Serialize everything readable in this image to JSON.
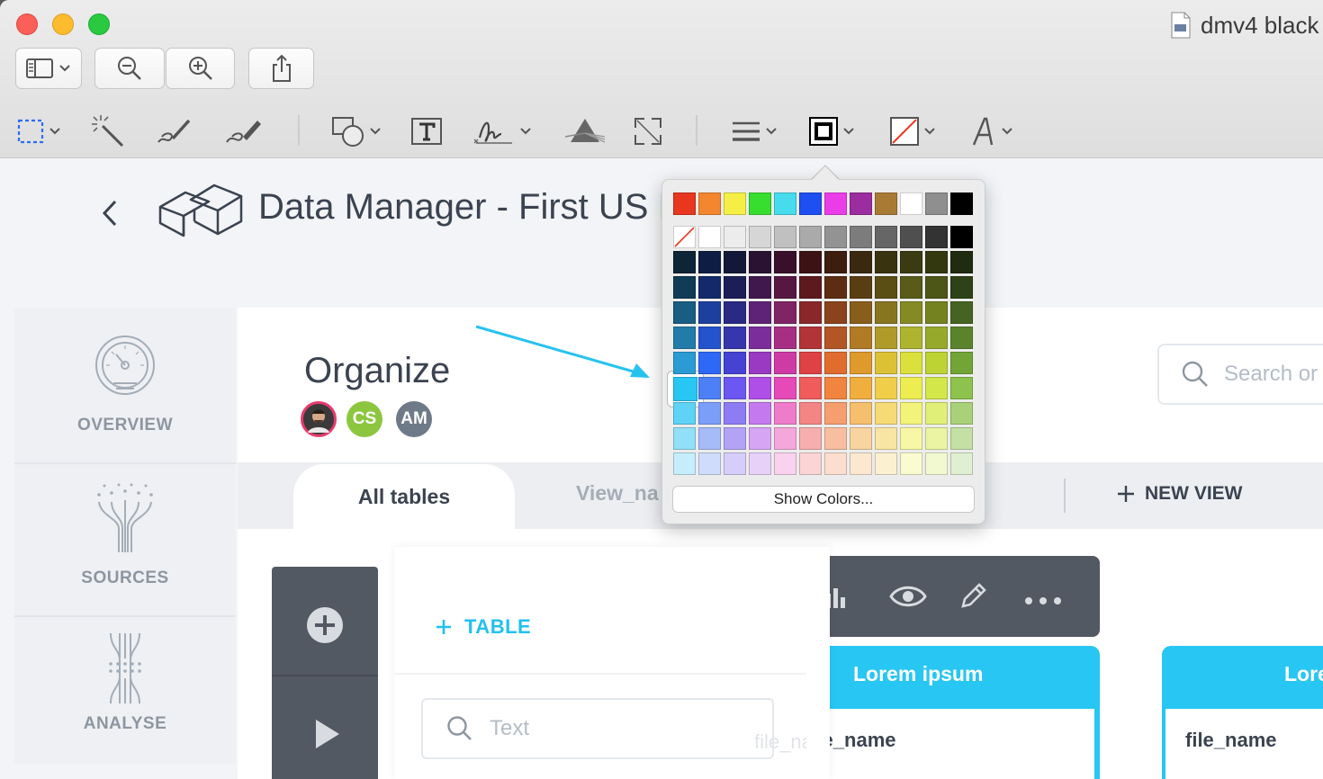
{
  "window": {
    "title": "dmv4 black"
  },
  "app": {
    "page_title": "Data Manager - First US D",
    "section_title": "Organize",
    "avatars": [
      {
        "initials": "",
        "color": "#3a3a3a",
        "ring": "#e83a6e"
      },
      {
        "initials": "CS",
        "color": "#8cc63f"
      },
      {
        "initials": "AM",
        "color": "#6e7a88"
      }
    ],
    "search_placeholder": "Search or",
    "sidebar": {
      "items": [
        {
          "label": "OVERVIEW",
          "icon": "gauge-icon"
        },
        {
          "label": "SOURCES",
          "icon": "sources-icon"
        },
        {
          "label": "ANALYSE",
          "icon": "analyse-icon"
        }
      ]
    },
    "tabs": [
      {
        "label": "All tables",
        "active": true
      },
      {
        "label": "View_na",
        "active": false
      }
    ],
    "new_view": "NEW VIEW",
    "add_table": "TABLE",
    "text_placeholder": "Text",
    "cards": [
      {
        "title": "Lorem ipsum",
        "field": "file_name"
      },
      {
        "title": "Lore",
        "field": "file_name"
      }
    ],
    "ghost_field": "file_name"
  },
  "color_picker": {
    "show_colors_label": "Show Colors...",
    "selected_color": "#28c6f3",
    "top_row": [
      "#e8361f",
      "#f3862f",
      "#f5ef45",
      "#37dd2f",
      "#46dcee",
      "#1d4ff1",
      "#ea3de8",
      "#9b2d9e",
      "#a97a34",
      "#ffffff",
      "#8f8f8f",
      "#000000"
    ],
    "gray_row": [
      "none",
      "#ffffff",
      "#ececec",
      "#d6d6d6",
      "#c0c0c0",
      "#aaaaaa",
      "#939393",
      "#7c7c7c",
      "#666666",
      "#4f4f4f",
      "#333333",
      "#000000"
    ],
    "grid": [
      [
        "#0d2536",
        "#0e1d44",
        "#141838",
        "#2a1233",
        "#38102a",
        "#3d1215",
        "#3c1d0e",
        "#3a290e",
        "#3a330f",
        "#3a3b12",
        "#33380f",
        "#1f2c10"
      ],
      [
        "#113c55",
        "#132a6a",
        "#1c1e57",
        "#40184e",
        "#561843",
        "#5c1a1e",
        "#5c2c13",
        "#5a3e13",
        "#5a4e15",
        "#585b19",
        "#4d5616",
        "#2e4218"
      ],
      [
        "#195d82",
        "#1d3f9e",
        "#2a2a85",
        "#5e2377",
        "#7f2465",
        "#8a272b",
        "#8a431c",
        "#885e1c",
        "#887520",
        "#868a25",
        "#748220",
        "#456322"
      ],
      [
        "#227ca9",
        "#2553cd",
        "#3836ad",
        "#7b2e9b",
        "#a62f84",
        "#b33437",
        "#b35625",
        "#b07b24",
        "#b09a2a",
        "#aeb430",
        "#97a92a",
        "#5b832c"
      ],
      [
        "#2a9bd3",
        "#2e68f6",
        "#4542d4",
        "#9a3ac2",
        "#cf3ba5",
        "#df4244",
        "#e06d2e",
        "#de9a2d",
        "#ddc135",
        "#dbe03c",
        "#bdd334",
        "#72a536"
      ],
      [
        "#28c6f3",
        "#4d80f6",
        "#6d57f2",
        "#b04ee8",
        "#e649b8",
        "#f05b5b",
        "#f1843f",
        "#f0ae3e",
        "#f0ce49",
        "#eded52",
        "#d3e74a",
        "#8dc34c"
      ],
      [
        "#5ed3f5",
        "#7b9ef8",
        "#8e7cf4",
        "#c47aee",
        "#ee7cca",
        "#f48585",
        "#f59f6f",
        "#f5c06d",
        "#f5da76",
        "#f3f37c",
        "#e0ef78",
        "#a9d179"
      ],
      [
        "#92e0f8",
        "#a6bcf9",
        "#b3a3f7",
        "#d6a5f3",
        "#f3a7da",
        "#f7aeae",
        "#f8bea0",
        "#f8d4a0",
        "#f8e5a3",
        "#f7f7a6",
        "#eaf4a3",
        "#c4e0a5"
      ],
      [
        "#c5edfb",
        "#d0dcfc",
        "#d6cdfa",
        "#e8d1f9",
        "#f9d3ed",
        "#fbd5d5",
        "#fbdecf",
        "#fbe8cf",
        "#fbf1d0",
        "#fbfbd2",
        "#f2f9d0",
        "#e0efd1"
      ]
    ]
  }
}
